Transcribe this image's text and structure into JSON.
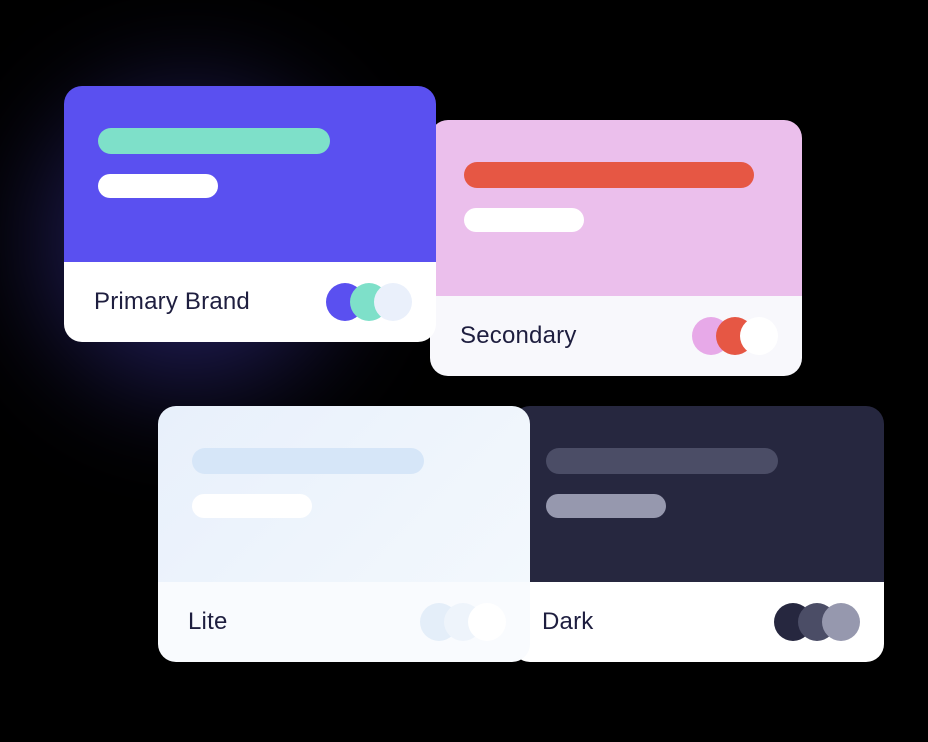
{
  "cards": {
    "primary": {
      "label": "Primary Brand",
      "swatches": [
        "#5A50F0",
        "#7EE0C9",
        "#EAF0FB"
      ]
    },
    "secondary": {
      "label": "Secondary",
      "swatches": [
        "#E7A9E8",
        "#E65744",
        "#FFFFFF"
      ]
    },
    "lite": {
      "label": "Lite",
      "swatches": [
        "#E4EEF9",
        "#EEF4FB",
        "#FFFFFF"
      ]
    },
    "dark": {
      "label": "Dark",
      "swatches": [
        "#26273F",
        "#4B4D66",
        "#9698AE"
      ]
    }
  }
}
